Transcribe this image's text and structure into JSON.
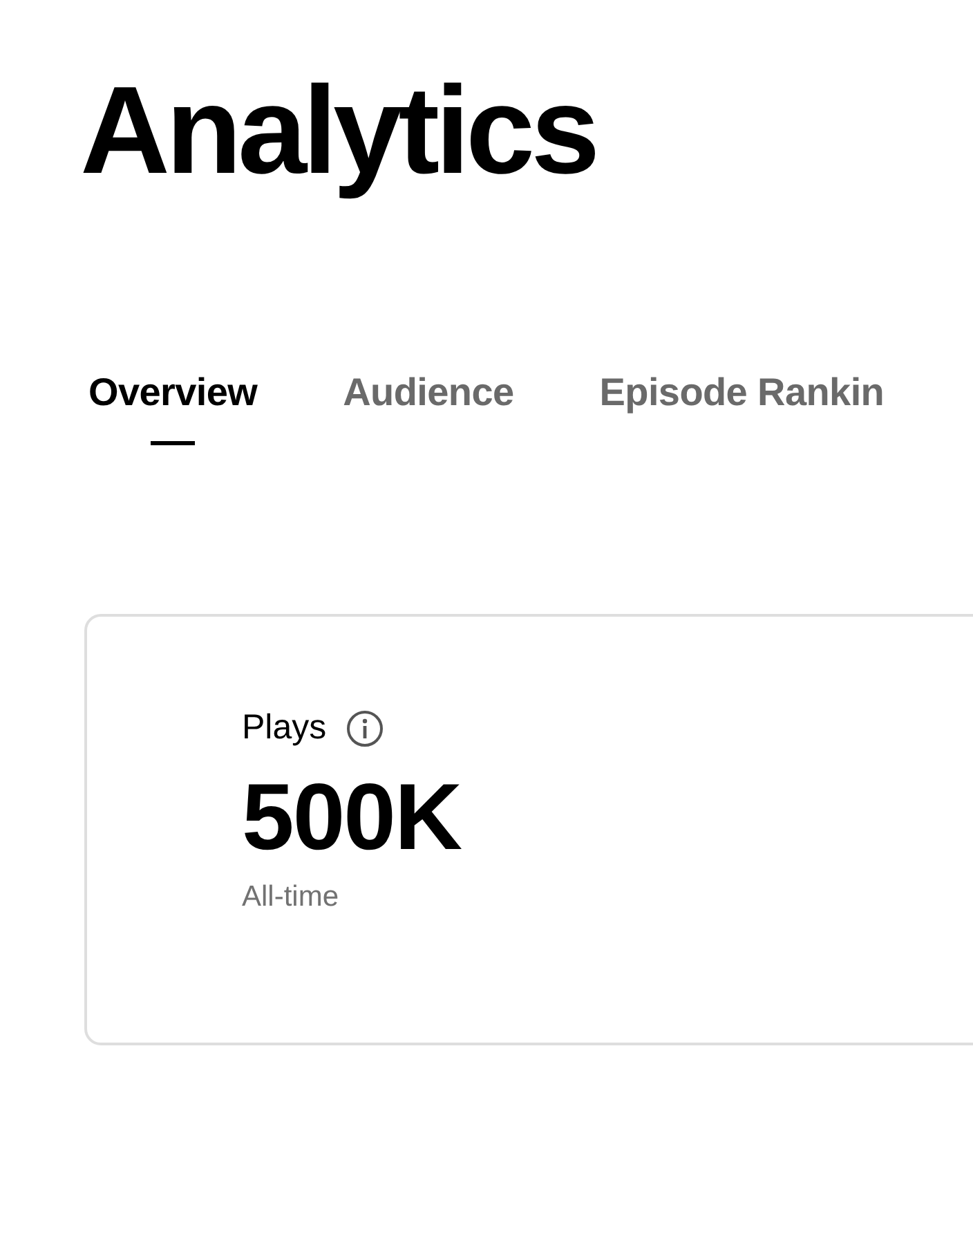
{
  "title": "Analytics",
  "tabs": [
    {
      "label": "Overview",
      "selected": true
    },
    {
      "label": "Audience",
      "selected": false
    },
    {
      "label": "Episode Rankin",
      "selected": false
    }
  ],
  "stat_card": {
    "label": "Plays",
    "value": "500K",
    "period": "All-time"
  }
}
